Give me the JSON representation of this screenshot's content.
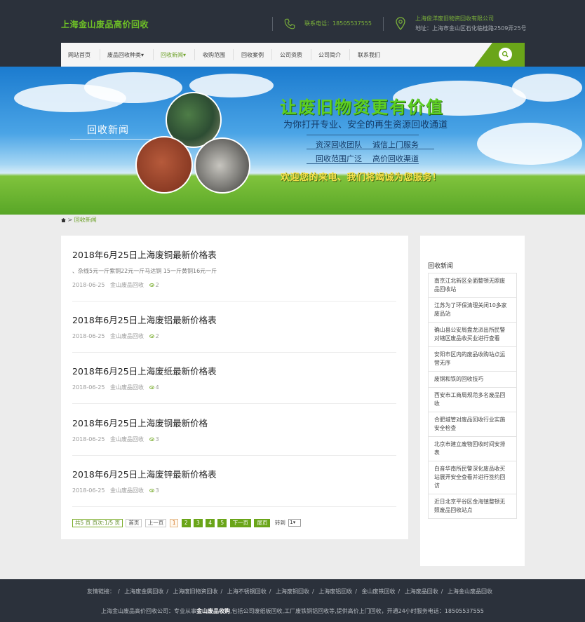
{
  "header": {
    "logo": "上海金山废品高价回收",
    "phone_label": "联系电话：18505537555",
    "company": "上海俊洋废旧物资回收有限公司",
    "address": "地址：上海市金山区石化临桂路2509弄25号"
  },
  "nav": {
    "items": [
      {
        "label": "网站首页"
      },
      {
        "label": "废品回收种类▾"
      },
      {
        "label": "回收新闻▾"
      },
      {
        "label": "收购范围"
      },
      {
        "label": "回收案例"
      },
      {
        "label": "公司资质"
      },
      {
        "label": "公司简介"
      },
      {
        "label": "联系我们"
      }
    ],
    "active_index": 2,
    "accent": "#6aa519"
  },
  "banner": {
    "title": "回收新闻",
    "slogan": "让废旧物资更有价值",
    "subline": "为你打开专业、安全的再生资源回收通道",
    "features": [
      "资深回收团队",
      "诚信上门服务",
      "回收范围广泛",
      "高价回收渠道"
    ],
    "welcome": "欢迎您的来电、我们将竭诚为您服务！"
  },
  "breadcrumb": {
    "separator": ">",
    "current": "回收新闻"
  },
  "articles": [
    {
      "title": "2018年6月25日上海废铜最新价格表",
      "excerpt": "、杂线5元一斤紫铜22元一斤马达铜 15一斤黄铜16元一斤",
      "date": "2018-06-25",
      "category": "金山废品回收",
      "views": "2"
    },
    {
      "title": "2018年6月25日上海废铝最新价格表",
      "excerpt": "",
      "date": "2018-06-25",
      "category": "金山废品回收",
      "views": "2"
    },
    {
      "title": "2018年6月25日上海废纸最新价格表",
      "excerpt": "",
      "date": "2018-06-25",
      "category": "金山废品回收",
      "views": "4"
    },
    {
      "title": "2018年6月25日上海废钢最新价格",
      "excerpt": "",
      "date": "2018-06-25",
      "category": "金山废品回收",
      "views": "3"
    },
    {
      "title": "2018年6月25日上海废锌最新价格表",
      "excerpt": "",
      "date": "2018-06-25",
      "category": "金山废品回收",
      "views": "3"
    }
  ],
  "pager": {
    "info": "共5 页 页次:1/5 页",
    "first": "首页",
    "prev": "上一页",
    "current": "1",
    "pages": [
      "2",
      "3",
      "4",
      "5"
    ],
    "next": "下一页",
    "last": "尾页",
    "jump_label": "转到",
    "jump_value": "1"
  },
  "sidebar": {
    "title": "回收新闻",
    "items": [
      {
        "label": "南京江北新区全面整顿无照废品回收站"
      },
      {
        "label": "江苏为了环保清理关闭10多家废品站"
      },
      {
        "label": "确山县公安局盘龙派出所民警对辖区废品收买业进行查看"
      },
      {
        "label": "安阳市区内的废品收购站点运营无序"
      },
      {
        "label": "废铜和铁的回收技巧"
      },
      {
        "label": "西安市工商局规范多名废品回收"
      },
      {
        "label": "合肥城管对废品回收行业实施安全检查"
      },
      {
        "label": "北京市建立废物回收时间安排表"
      },
      {
        "label": "白音华南所民警深化废品收买站展开安全查看并进行签约回访"
      },
      {
        "label": "近日北京平谷区金海镇整顿无照废品回收站点"
      }
    ]
  },
  "footer": {
    "friends_label": "友情链接：",
    "friends": [
      {
        "label": "上海废金属回收"
      },
      {
        "label": "上海废旧物资回收"
      },
      {
        "label": "上海不锈钢回收"
      },
      {
        "label": "上海废铜回收"
      },
      {
        "label": "上海废铝回收"
      },
      {
        "label": "金山废铁回收"
      },
      {
        "label": "上海废品回收"
      },
      {
        "label": "上海金山废品回收"
      }
    ],
    "copyright_pre": "上海金山废品高价回收公司：专业从事",
    "copyright_bold": "金山废品收购",
    "copyright_post": ",包括公司废纸板回收,工厂废铁铜铝回收等,提供高价上门回收，开通24小时服务电话：18505537555"
  }
}
